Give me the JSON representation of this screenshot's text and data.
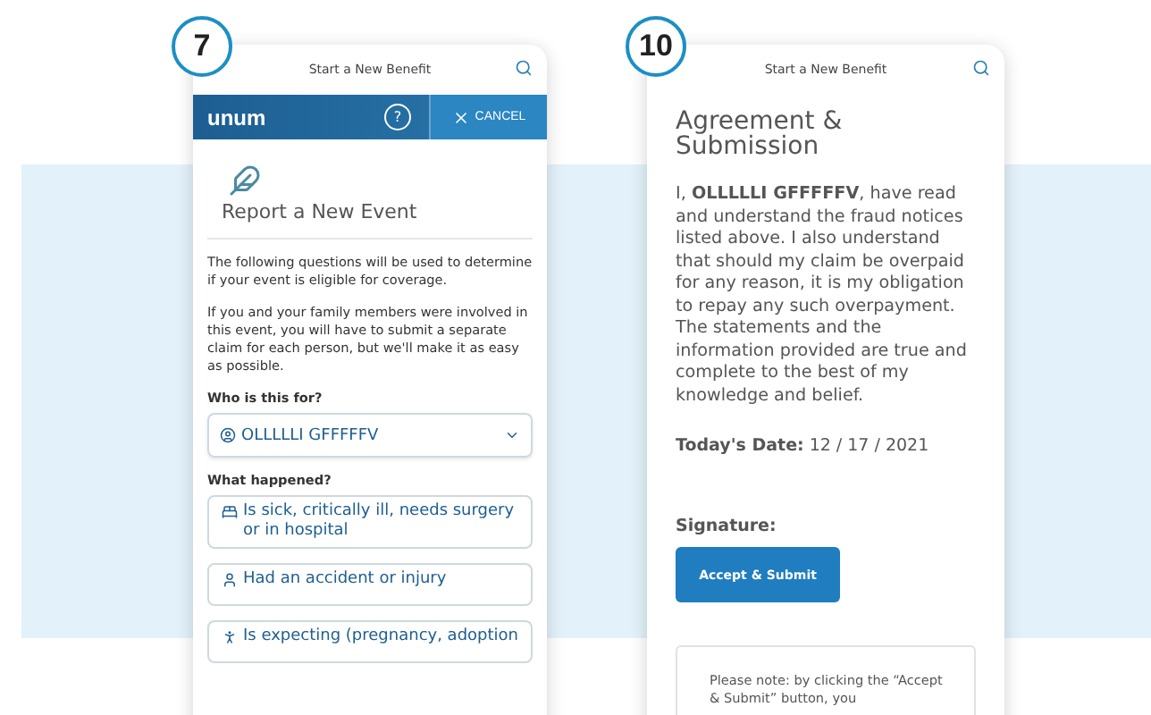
{
  "screens": [
    {
      "step": "7",
      "header": {
        "title": "Start a New Benefit"
      },
      "brand_bar": {
        "logo": "unum",
        "help": "?",
        "cancel": "CANCEL"
      },
      "heading": "Report a New Event",
      "paragraphs": [
        "The following questions will be used to determine if your event is eligible for coverage.",
        "If you and your family members were involved in this event, you will have to submit a separate claim for each person, but we'll make it as easy as possible."
      ],
      "who_label": "Who is this for?",
      "who_value": "OLLLLLI GFFFFFV",
      "what_label": "What happened?",
      "options": [
        {
          "kind": "illness",
          "label": "Is sick, critically ill, needs surgery or in hospital"
        },
        {
          "kind": "injury",
          "label": "Had an accident or injury"
        },
        {
          "kind": "expecting",
          "label": "Is expecting (pregnancy, adoption"
        }
      ]
    },
    {
      "step": "10",
      "header": {
        "title": "Start a New Benefit"
      },
      "heading": "Agreement & Submission",
      "statement": "I, **OLLLLLI GFFFFFV**, have read and understand the fraud notices listed above. I also understand that should my claim be overpaid for any reason, it is my obligation to repay any such overpayment. The statements and the information provided are true and complete to the best of my knowledge and belief.",
      "date_label": "Today's Date:",
      "date_value": "12 / 17 / 2021",
      "signature_label": "Signature:",
      "submit": "Accept & Submit",
      "note": "Please note: by clicking the “Accept & Submit” button, you"
    }
  ]
}
